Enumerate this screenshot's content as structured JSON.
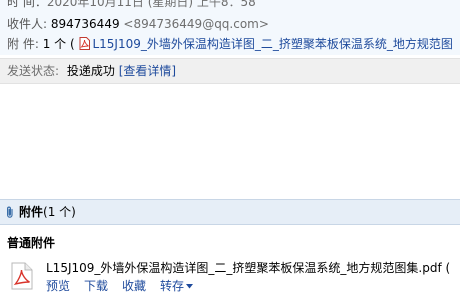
{
  "header": {
    "time_label": "时  间：",
    "time_value": "2020年10月11日 (星期日) 上午8：58",
    "recipient_label": "收件人:",
    "recipient_name": "894736449",
    "recipient_email": "<894736449@qq.com>",
    "attachment_label": "附  件:",
    "attachment_count": "1 个 (",
    "attachment_name": "L15J109_外墙外保温构造详图_二_挤塑聚苯板保温系统_地方规范图"
  },
  "status": {
    "label": "发送状态:",
    "value": "投递成功",
    "detail_link": "[查看详情]"
  },
  "attachments": {
    "title": "附件",
    "count": "(1 个)",
    "section_title": "普通附件",
    "file_name": "L15J109_外墙外保温构造详图_二_挤塑聚苯板保温系统_地方规范图集.pdf (",
    "actions": [
      "预览",
      "下载",
      "收藏",
      "转存"
    ]
  },
  "colors": {
    "link": "#1e4a9c",
    "header_bg": "#f3f8fd",
    "status_bg": "#f0f0f0",
    "attachment_bar_bg": "#e6eef7",
    "pdf_icon": "#d9342b"
  }
}
